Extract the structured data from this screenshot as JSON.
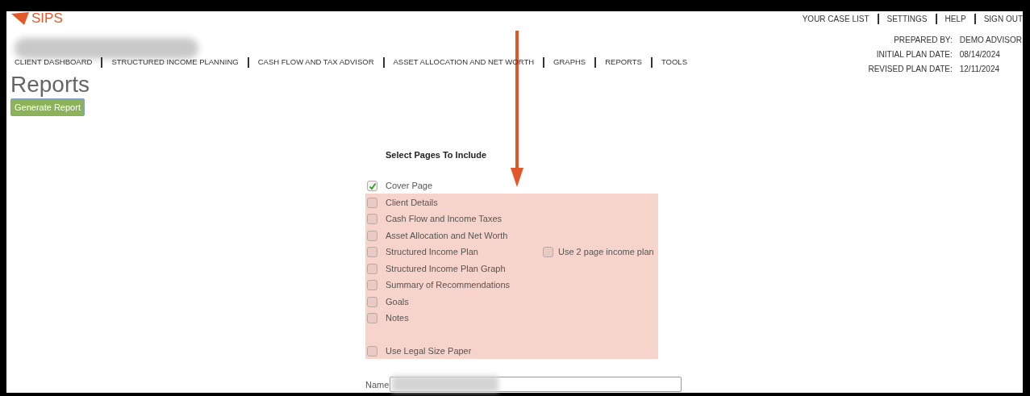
{
  "logo": {
    "name": "SIPS"
  },
  "top_links": [
    "YOUR CASE LIST",
    "SETTINGS",
    "HELP",
    "SIGN OUT"
  ],
  "plan_info": [
    {
      "label": "PREPARED BY:",
      "value": "DEMO ADVISOR"
    },
    {
      "label": "INITIAL PLAN DATE:",
      "value": "08/14/2024"
    },
    {
      "label": "REVISED PLAN DATE:",
      "value": "12/11/2024"
    }
  ],
  "nav": [
    "CLIENT DASHBOARD",
    "STRUCTURED INCOME PLANNING",
    "CASH FLOW AND TAX ADVISOR",
    "ASSET ALLOCATION AND NET WORTH",
    "GRAPHS",
    "REPORTS",
    "TOOLS"
  ],
  "title": "Reports",
  "generate_button": "Generate Report",
  "section_title": "Select Pages To Include",
  "pages": [
    {
      "label": "Cover Page",
      "checked": true,
      "highlighted": false
    },
    {
      "label": "Client Details",
      "checked": false,
      "highlighted": true
    },
    {
      "label": "Cash Flow and Income Taxes",
      "checked": false,
      "highlighted": true
    },
    {
      "label": "Asset Allocation and Net Worth",
      "checked": false,
      "highlighted": true
    },
    {
      "label": "Structured Income Plan",
      "checked": false,
      "highlighted": true,
      "option": {
        "label": "Use 2 page income plan",
        "checked": false
      }
    },
    {
      "label": "Structured Income Plan Graph",
      "checked": false,
      "highlighted": true
    },
    {
      "label": "Summary of Recommendations",
      "checked": false,
      "highlighted": true
    },
    {
      "label": "Goals",
      "checked": false,
      "highlighted": true
    },
    {
      "label": "Notes",
      "checked": false,
      "highlighted": true
    },
    {
      "label": "Use Legal Size Paper",
      "checked": false,
      "highlighted": true,
      "spaced": true
    }
  ],
  "name_field": {
    "label": "Name"
  }
}
